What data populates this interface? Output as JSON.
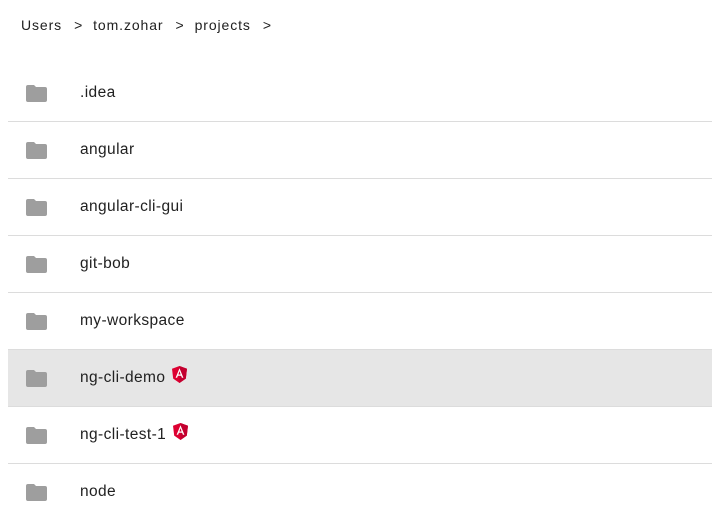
{
  "breadcrumb": {
    "items": [
      "Users",
      "tom.zohar",
      "projects"
    ],
    "separator": ">"
  },
  "colors": {
    "folder": "#9e9e9e",
    "selected_row": "#e6e6e6",
    "angular_red": "#dd0031",
    "divider": "#dcdcdc"
  },
  "folders": [
    {
      "name": ".idea",
      "angular": false,
      "selected": false
    },
    {
      "name": "angular",
      "angular": false,
      "selected": false
    },
    {
      "name": "angular-cli-gui",
      "angular": false,
      "selected": false
    },
    {
      "name": "git-bob",
      "angular": false,
      "selected": false
    },
    {
      "name": "my-workspace",
      "angular": false,
      "selected": false
    },
    {
      "name": "ng-cli-demo",
      "angular": true,
      "selected": true
    },
    {
      "name": "ng-cli-test-1",
      "angular": true,
      "selected": false
    },
    {
      "name": "node",
      "angular": false,
      "selected": false
    }
  ],
  "icons": {
    "folder": "folder-icon",
    "angular": "angular-icon"
  }
}
